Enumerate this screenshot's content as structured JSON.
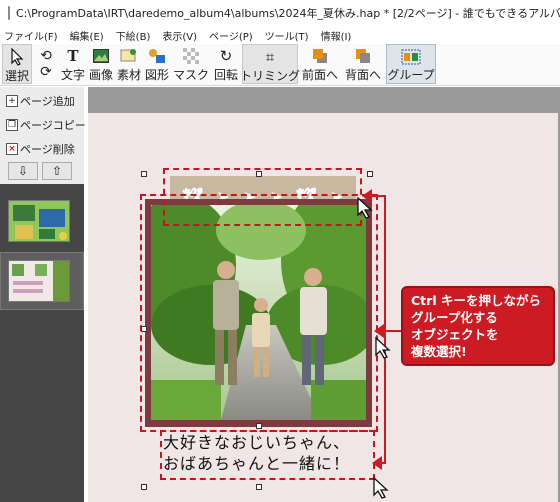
{
  "window": {
    "title": "C:\\ProgramData\\IRT\\daredemo_album4\\albums\\2024年_夏休み.hap * [2/2ページ] - 誰でもできるアルバム"
  },
  "menu": {
    "items": [
      "ファイル(F)",
      "編集(E)",
      "下絵(B)",
      "表示(V)",
      "ページ(P)",
      "ツール(T)",
      "情報(I)"
    ]
  },
  "toolbar": {
    "select": "選択",
    "undo_redo": "",
    "text": "文字",
    "image": "画像",
    "material": "素材",
    "shape": "図形",
    "mask": "マスク",
    "rotate": "回転",
    "trimming": "トリミング",
    "bring_front": "前面へ",
    "send_back": "背面へ",
    "group": "グループ"
  },
  "side_panel": {
    "add_page": "ページ追加",
    "copy_page": "ページコピー",
    "delete_page": "ページ削除",
    "arrow_down": "⇩",
    "arrow_up": "⇧"
  },
  "canvas": {
    "caption_line1": "大好きなおじいちゃん、",
    "caption_line2": "おばあちゃんと一緒に！"
  },
  "callout": {
    "line1": "Ctrl キーを押しながら",
    "line2": "グループ化する",
    "line3": "オブジェクトを",
    "line4": "複数選択!"
  },
  "colors": {
    "accent_red": "#cc1b22",
    "frame_brown": "#7b3b3f",
    "banner_beige": "#c8b8a0",
    "workspace_bg": "#f0e6e6"
  }
}
